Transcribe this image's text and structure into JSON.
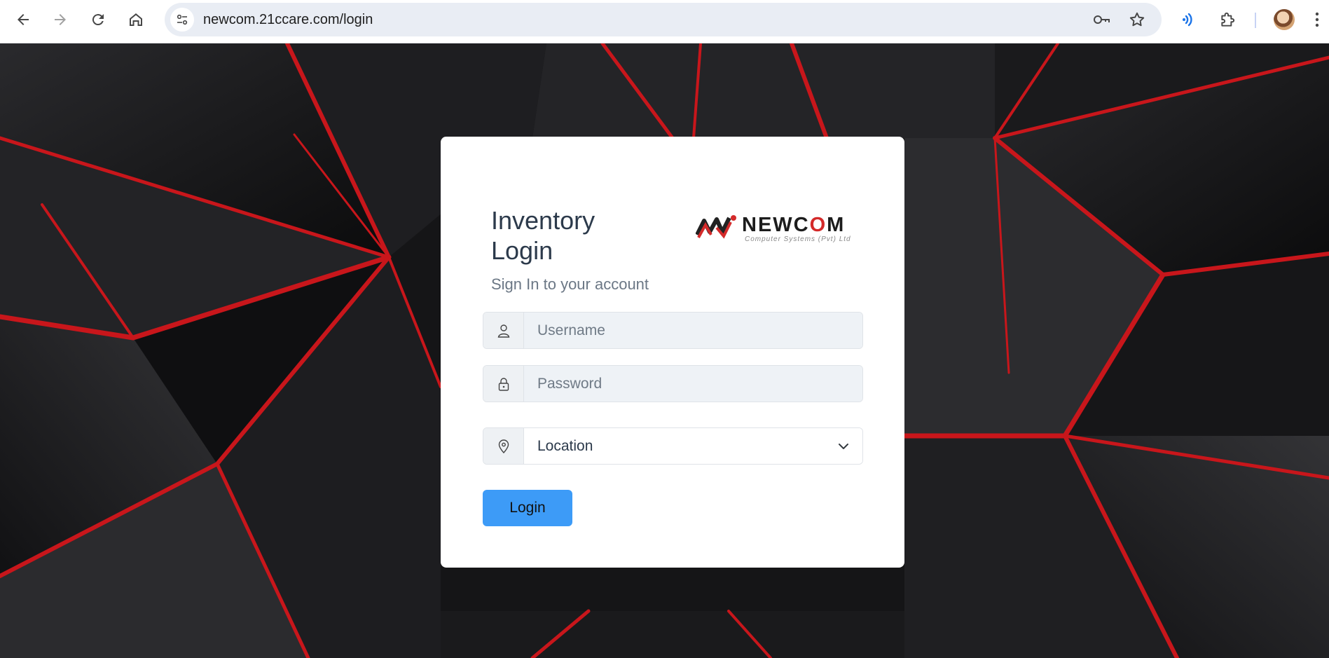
{
  "browser": {
    "url": "newcom.21ccare.com/login",
    "icons": [
      "back-arrow-icon",
      "forward-arrow-icon",
      "reload-icon",
      "home-icon",
      "site-info-icon",
      "password-key-icon",
      "bookmark-star-icon",
      "read-aloud-icon",
      "extensions-puzzle-icon",
      "profile-avatar",
      "more-menu-icon"
    ]
  },
  "login": {
    "title": "Inventory Login",
    "subtitle": "Sign In to your account",
    "username_placeholder": "Username",
    "password_placeholder": "Password",
    "location_selected": "Location",
    "submit_label": "Login"
  },
  "logo": {
    "brand_prefix": "NEWC",
    "brand_o": "O",
    "brand_suffix": "M",
    "tagline": "Computer Systems (Pvt) Ltd"
  },
  "colors": {
    "accent_blue": "#3d9bf7",
    "brand_red": "#d42a2a",
    "background_red": "#c8161b",
    "background_dark": "#111113"
  }
}
